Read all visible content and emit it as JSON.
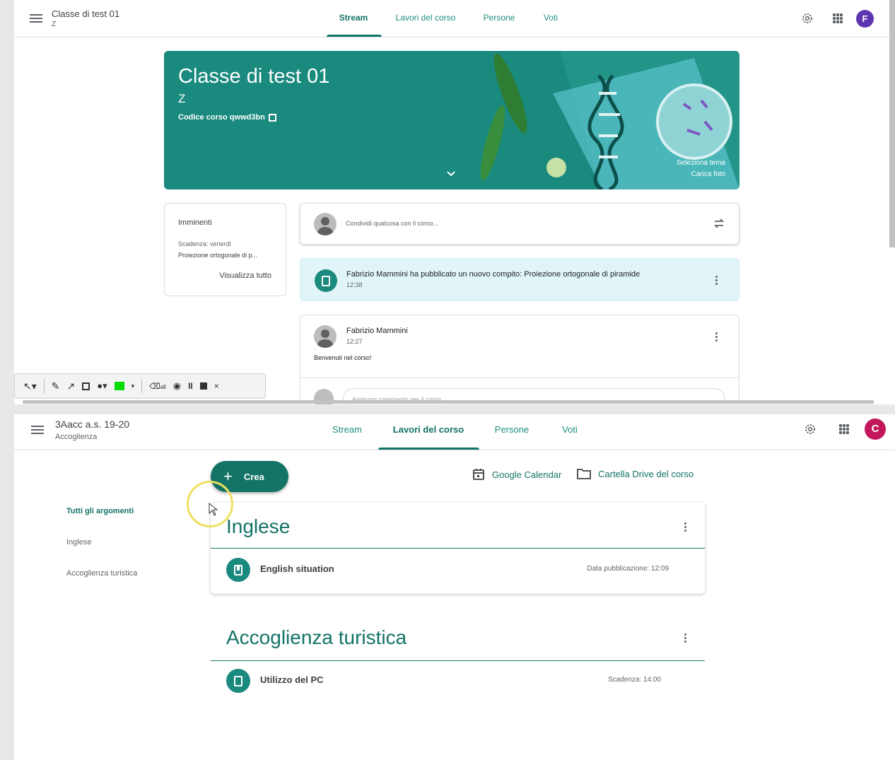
{
  "top": {
    "class_title": "Classe di test 01",
    "class_section": "Z",
    "tabs": [
      "Stream",
      "Lavori del corso",
      "Persone",
      "Voti"
    ],
    "avatar_letter": "F",
    "avatar_color": "#5e35b1",
    "banner": {
      "title": "Classe di test 01",
      "section": "Z",
      "code_label": "Codice corso",
      "code_value": "qwwd3bn",
      "select_theme": "Seleziona tema",
      "upload_photo": "Carica foto"
    },
    "upcoming": {
      "title": "Imminenti",
      "due": "Scadenza: venerdì",
      "task": "Proiezione ortogonale di p...",
      "view_all": "Visualizza tutto"
    },
    "share_placeholder": "Condividi qualcosa con il corso...",
    "post1": {
      "text": "Fabrizio Mammini ha pubblicato un nuovo compito: Proiezione ortogonale di piramide",
      "time": "12:38"
    },
    "post2": {
      "author": "Fabrizio Mammini",
      "time": "12:27",
      "body": "Benvenuti nel corso!",
      "comment_placeholder": "Aggiungi commento per il corso..."
    },
    "toolbar_eraser_label": "all",
    "toolbar_color": "#00dd00"
  },
  "bottom": {
    "class_title": "3Aacc a.s. 19-20",
    "class_section": "Accoglienza",
    "tabs": [
      "Stream",
      "Lavori del corso",
      "Persone",
      "Voti"
    ],
    "avatar_letter": "C",
    "avatar_color": "#c2185b",
    "create_label": "Crea",
    "calendar_label": "Google Calendar",
    "drive_label": "Cartella Drive del corso",
    "topics_nav": [
      "Tutti gli argomenti",
      "Inglese",
      "Accoglienza turistica"
    ],
    "topic1": {
      "title": "Inglese",
      "item": "English situation",
      "meta": "Data pubblicazione: 12:09"
    },
    "topic2": {
      "title": "Accoglienza turistica",
      "item": "Utilizzo del PC",
      "meta": "Scadenza: 14:00"
    }
  }
}
